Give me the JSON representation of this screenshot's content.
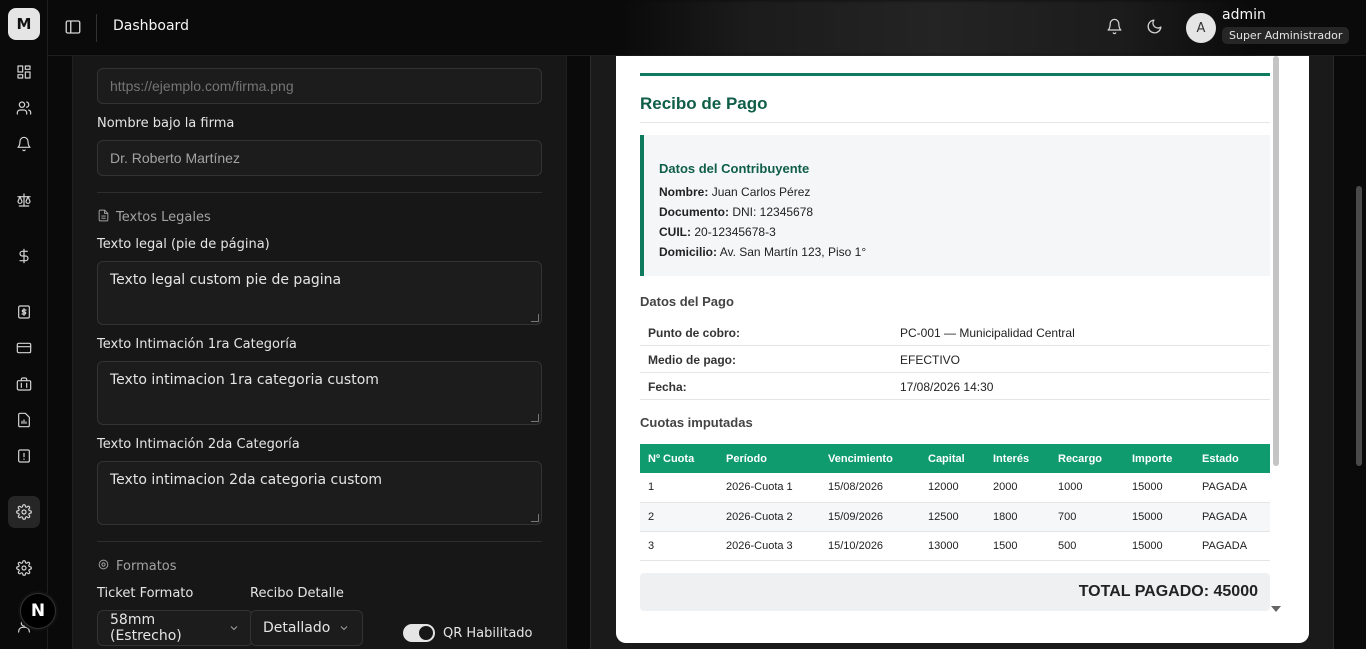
{
  "rail": {
    "logo": "M",
    "next_badge": "N"
  },
  "topbar": {
    "title": "Dashboard",
    "user_initial": "A",
    "user_name": "admin",
    "user_role": "Super Administrador"
  },
  "form": {
    "firma_url_placeholder": "https://ejemplo.com/firma.png",
    "nombre_firma_label": "Nombre bajo la firma",
    "nombre_firma_value": "Dr. Roberto Martínez",
    "textos_legales_heading": "Textos Legales",
    "texto_legal_label": "Texto legal (pie de página)",
    "texto_legal_value": "Texto legal custom pie de pagina",
    "intimacion1_label": "Texto Intimación 1ra Categoría",
    "intimacion1_value": "Texto intimacion 1ra categoria  custom",
    "intimacion2_label": "Texto Intimación 2da Categoría",
    "intimacion2_value": "Texto intimacion 2da categoria  custom",
    "formatos_heading": "Formatos",
    "ticket_formato_label": "Ticket Formato",
    "ticket_formato_value": "58mm (Estrecho)",
    "recibo_detalle_label": "Recibo Detalle",
    "recibo_detalle_value": "Detallado",
    "qr_label": "QR Habilitado"
  },
  "receipt": {
    "title": "Recibo de Pago",
    "contribuyente": {
      "title": "Datos del Contribuyente",
      "nombre_k": "Nombre:",
      "nombre_v": "Juan Carlos Pérez",
      "documento_k": "Documento:",
      "documento_v": "DNI: 12345678",
      "cuil_k": "CUIL:",
      "cuil_v": "20-12345678-3",
      "domicilio_k": "Domicilio:",
      "domicilio_v": "Av. San Martín 123, Piso 1°"
    },
    "pago": {
      "title": "Datos del Pago",
      "rows": [
        {
          "k": "Punto de cobro:",
          "v": "PC-001 — Municipalidad Central"
        },
        {
          "k": "Medio de pago:",
          "v": "EFECTIVO"
        },
        {
          "k": "Fecha:",
          "v": "17/08/2026 14:30"
        }
      ]
    },
    "cuotas": {
      "title": "Cuotas imputadas",
      "headers": [
        "Nº Cuota",
        "Período",
        "Vencimiento",
        "Capital",
        "Interés",
        "Recargo",
        "Importe",
        "Estado"
      ],
      "rows": [
        [
          "1",
          "2026-Cuota 1",
          "15/08/2026",
          "12000",
          "2000",
          "1000",
          "15000",
          "PAGADA"
        ],
        [
          "2",
          "2026-Cuota 2",
          "15/09/2026",
          "12500",
          "1800",
          "700",
          "15000",
          "PAGADA"
        ],
        [
          "3",
          "2026-Cuota 3",
          "15/10/2026",
          "13000",
          "1500",
          "500",
          "15000",
          "PAGADA"
        ]
      ]
    },
    "total": "TOTAL PAGADO: 45000"
  }
}
